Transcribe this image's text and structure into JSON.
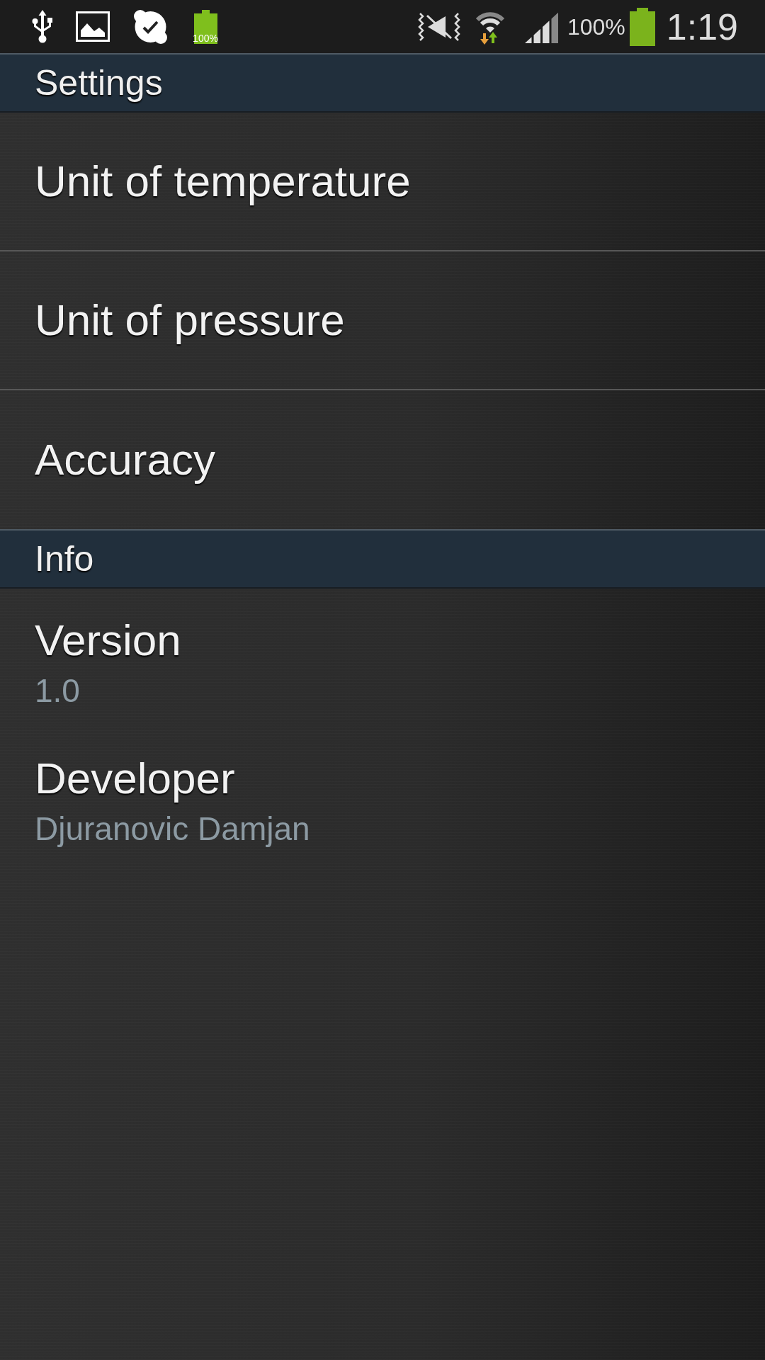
{
  "status_bar": {
    "notification_battery_label": "100%",
    "battery_percent": "100%",
    "time": "1:19"
  },
  "sections": [
    {
      "title": "Settings",
      "items": [
        {
          "kind": "option",
          "title": "Unit of temperature"
        },
        {
          "kind": "option",
          "title": "Unit of pressure"
        },
        {
          "kind": "option",
          "title": "Accuracy"
        }
      ]
    },
    {
      "title": "Info",
      "items": [
        {
          "kind": "info",
          "title": "Version",
          "summary": "1.0"
        },
        {
          "kind": "info",
          "title": "Developer",
          "summary": "Djuranovic Damjan"
        }
      ]
    }
  ]
}
